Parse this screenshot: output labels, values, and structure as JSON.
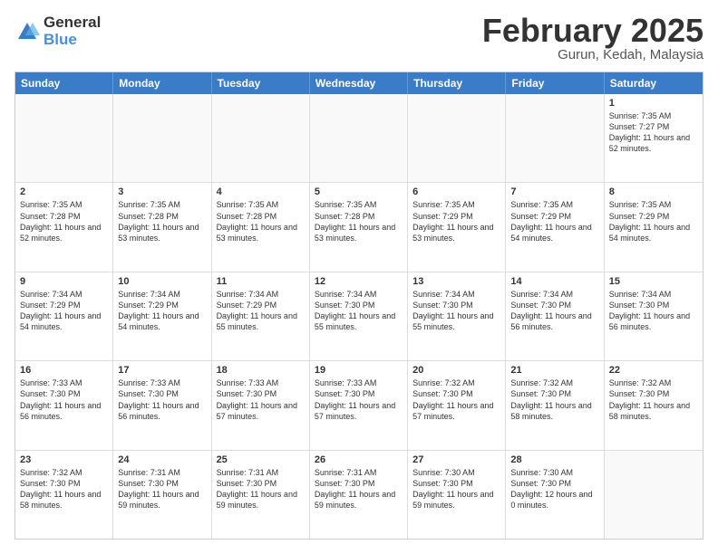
{
  "logo": {
    "general": "General",
    "blue": "Blue"
  },
  "title": "February 2025",
  "location": "Gurun, Kedah, Malaysia",
  "weekdays": [
    "Sunday",
    "Monday",
    "Tuesday",
    "Wednesday",
    "Thursday",
    "Friday",
    "Saturday"
  ],
  "rows": [
    [
      {
        "day": "",
        "info": ""
      },
      {
        "day": "",
        "info": ""
      },
      {
        "day": "",
        "info": ""
      },
      {
        "day": "",
        "info": ""
      },
      {
        "day": "",
        "info": ""
      },
      {
        "day": "",
        "info": ""
      },
      {
        "day": "1",
        "info": "Sunrise: 7:35 AM\nSunset: 7:27 PM\nDaylight: 11 hours and 52 minutes."
      }
    ],
    [
      {
        "day": "2",
        "info": "Sunrise: 7:35 AM\nSunset: 7:28 PM\nDaylight: 11 hours and 52 minutes."
      },
      {
        "day": "3",
        "info": "Sunrise: 7:35 AM\nSunset: 7:28 PM\nDaylight: 11 hours and 53 minutes."
      },
      {
        "day": "4",
        "info": "Sunrise: 7:35 AM\nSunset: 7:28 PM\nDaylight: 11 hours and 53 minutes."
      },
      {
        "day": "5",
        "info": "Sunrise: 7:35 AM\nSunset: 7:28 PM\nDaylight: 11 hours and 53 minutes."
      },
      {
        "day": "6",
        "info": "Sunrise: 7:35 AM\nSunset: 7:29 PM\nDaylight: 11 hours and 53 minutes."
      },
      {
        "day": "7",
        "info": "Sunrise: 7:35 AM\nSunset: 7:29 PM\nDaylight: 11 hours and 54 minutes."
      },
      {
        "day": "8",
        "info": "Sunrise: 7:35 AM\nSunset: 7:29 PM\nDaylight: 11 hours and 54 minutes."
      }
    ],
    [
      {
        "day": "9",
        "info": "Sunrise: 7:34 AM\nSunset: 7:29 PM\nDaylight: 11 hours and 54 minutes."
      },
      {
        "day": "10",
        "info": "Sunrise: 7:34 AM\nSunset: 7:29 PM\nDaylight: 11 hours and 54 minutes."
      },
      {
        "day": "11",
        "info": "Sunrise: 7:34 AM\nSunset: 7:29 PM\nDaylight: 11 hours and 55 minutes."
      },
      {
        "day": "12",
        "info": "Sunrise: 7:34 AM\nSunset: 7:30 PM\nDaylight: 11 hours and 55 minutes."
      },
      {
        "day": "13",
        "info": "Sunrise: 7:34 AM\nSunset: 7:30 PM\nDaylight: 11 hours and 55 minutes."
      },
      {
        "day": "14",
        "info": "Sunrise: 7:34 AM\nSunset: 7:30 PM\nDaylight: 11 hours and 56 minutes."
      },
      {
        "day": "15",
        "info": "Sunrise: 7:34 AM\nSunset: 7:30 PM\nDaylight: 11 hours and 56 minutes."
      }
    ],
    [
      {
        "day": "16",
        "info": "Sunrise: 7:33 AM\nSunset: 7:30 PM\nDaylight: 11 hours and 56 minutes."
      },
      {
        "day": "17",
        "info": "Sunrise: 7:33 AM\nSunset: 7:30 PM\nDaylight: 11 hours and 56 minutes."
      },
      {
        "day": "18",
        "info": "Sunrise: 7:33 AM\nSunset: 7:30 PM\nDaylight: 11 hours and 57 minutes."
      },
      {
        "day": "19",
        "info": "Sunrise: 7:33 AM\nSunset: 7:30 PM\nDaylight: 11 hours and 57 minutes."
      },
      {
        "day": "20",
        "info": "Sunrise: 7:32 AM\nSunset: 7:30 PM\nDaylight: 11 hours and 57 minutes."
      },
      {
        "day": "21",
        "info": "Sunrise: 7:32 AM\nSunset: 7:30 PM\nDaylight: 11 hours and 58 minutes."
      },
      {
        "day": "22",
        "info": "Sunrise: 7:32 AM\nSunset: 7:30 PM\nDaylight: 11 hours and 58 minutes."
      }
    ],
    [
      {
        "day": "23",
        "info": "Sunrise: 7:32 AM\nSunset: 7:30 PM\nDaylight: 11 hours and 58 minutes."
      },
      {
        "day": "24",
        "info": "Sunrise: 7:31 AM\nSunset: 7:30 PM\nDaylight: 11 hours and 59 minutes."
      },
      {
        "day": "25",
        "info": "Sunrise: 7:31 AM\nSunset: 7:30 PM\nDaylight: 11 hours and 59 minutes."
      },
      {
        "day": "26",
        "info": "Sunrise: 7:31 AM\nSunset: 7:30 PM\nDaylight: 11 hours and 59 minutes."
      },
      {
        "day": "27",
        "info": "Sunrise: 7:30 AM\nSunset: 7:30 PM\nDaylight: 11 hours and 59 minutes."
      },
      {
        "day": "28",
        "info": "Sunrise: 7:30 AM\nSunset: 7:30 PM\nDaylight: 12 hours and 0 minutes."
      },
      {
        "day": "",
        "info": ""
      }
    ]
  ]
}
